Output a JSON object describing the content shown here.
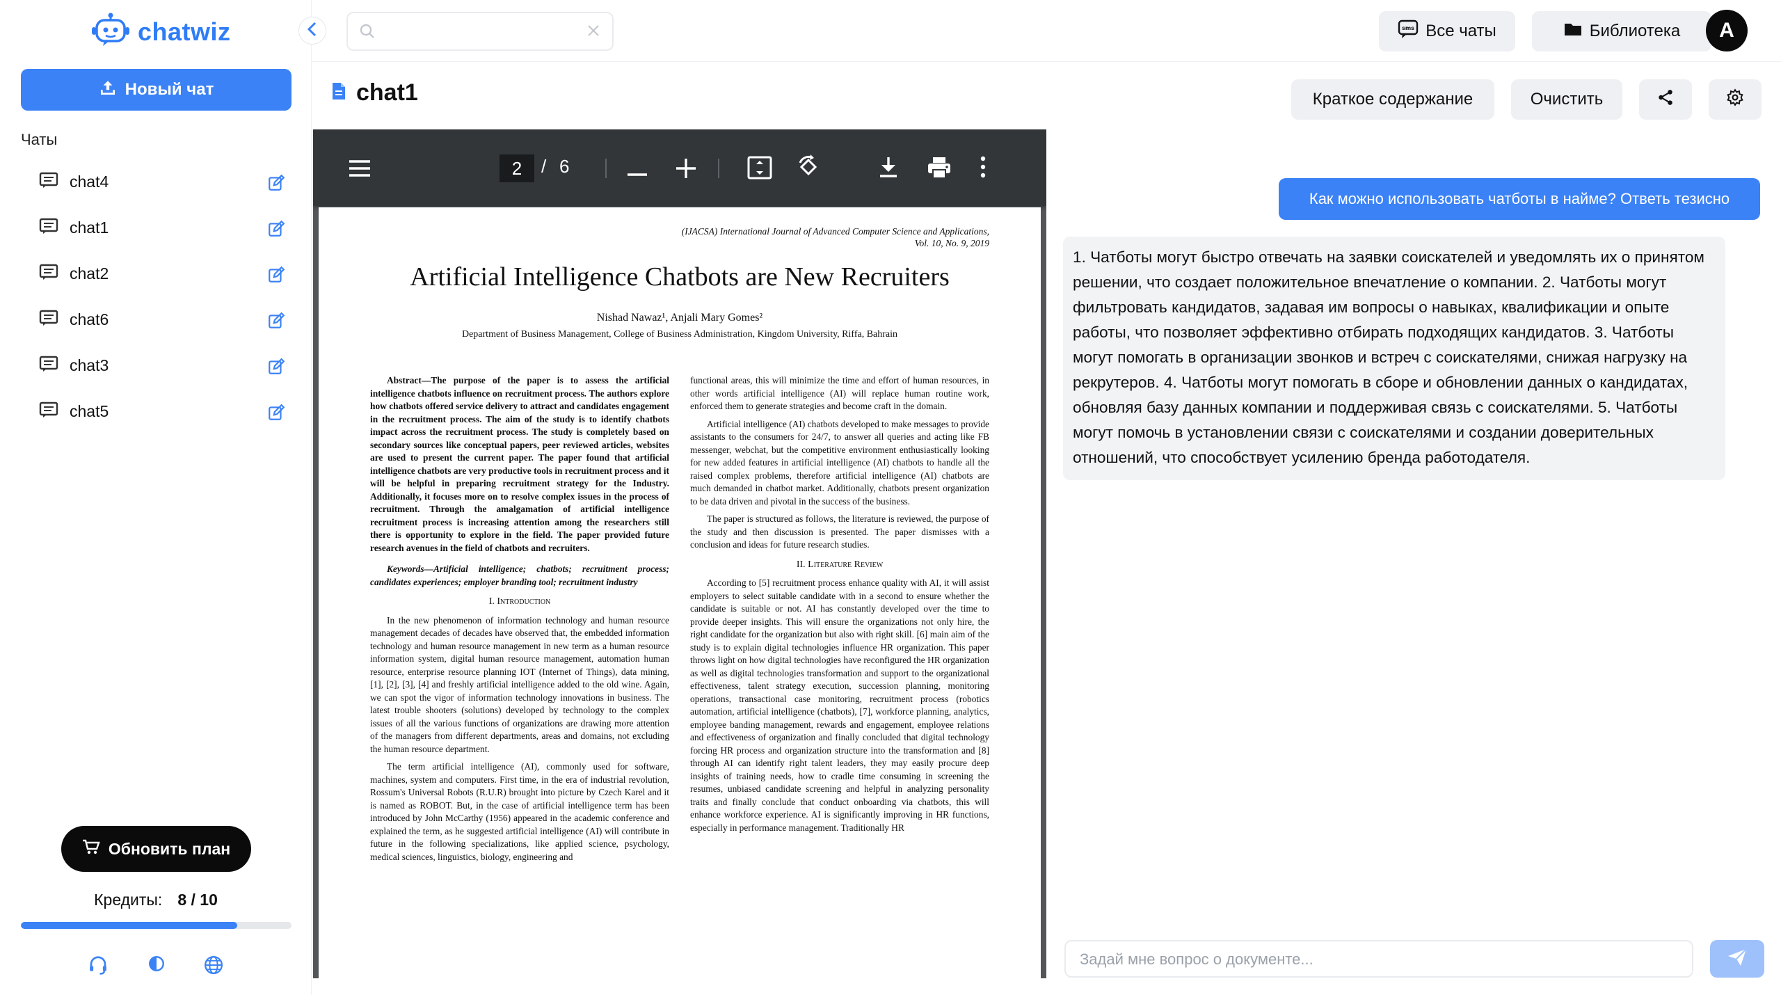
{
  "app": {
    "name": "chatwiz",
    "accent": "#3b82f6"
  },
  "sidebar": {
    "new_chat_label": "Новый чат",
    "chats_heading": "Чаты",
    "chats": [
      {
        "label": "chat4"
      },
      {
        "label": "chat1"
      },
      {
        "label": "chat2"
      },
      {
        "label": "chat6"
      },
      {
        "label": "chat3"
      },
      {
        "label": "chat5"
      }
    ],
    "upgrade_label": "Обновить план",
    "credits_label": "Кредиты:",
    "credits_value": "8 / 10",
    "credits_fraction": 0.8,
    "bottom_icons": [
      "headset-icon",
      "contrast-icon",
      "globe-icon"
    ]
  },
  "search": {
    "placeholder": ""
  },
  "header": {
    "all_chats_label": "Все чаты",
    "library_label": "Библиотека",
    "avatar_letter": "A"
  },
  "document": {
    "title": "chat1",
    "summary_label": "Краткое содержание",
    "clear_label": "Очистить"
  },
  "pdf": {
    "current_page": "2",
    "separator": "/",
    "total_pages": "6",
    "journal_line1": "(IJACSA) International Journal of Advanced Computer Science and Applications,",
    "journal_line2": "Vol. 10, No. 9, 2019",
    "title": "Artificial Intelligence Chatbots are New Recruiters",
    "authors": "Nishad Nawaz¹, Anjali Mary Gomes²",
    "department": "Department of Business Management, College of Business Administration, Kingdom University, Riffa, Bahrain",
    "abstract": "Abstract—The purpose of the paper is to assess the artificial intelligence chatbots influence on recruitment process. The authors explore how chatbots offered service delivery to attract and candidates engagement in the recruitment process. The aim of the study is to identify chatbots impact across the recruitment process. The study is completely based on secondary sources like conceptual papers, peer reviewed articles, websites are used to present the current paper. The paper found that artificial intelligence chatbots are very productive tools in recruitment process and it will be helpful in preparing recruitment strategy for the Industry. Additionally, it focuses more on to resolve complex issues in the process of recruitment. Through the amalgamation of artificial intelligence recruitment process is increasing attention among the researchers still there is opportunity to explore in the field. The paper provided future research avenues in the field of chatbots and recruiters.",
    "keywords": "Keywords—Artificial intelligence; chatbots; recruitment process; candidates experiences; employer branding tool; recruitment industry",
    "sec1": "I. Introduction",
    "intro_p1": "In the new phenomenon of information technology and human resource management decades of decades have observed that, the embedded information technology and human resource management in new term as a human resource information system, digital human resource management, automation human resource, enterprise resource planning IOT (Internet of Things), data mining, [1], [2], [3], [4] and freshly artificial intelligence added to the old wine. Again, we can spot the vigor of information technology innovations in business. The latest trouble shooters (solutions) developed by technology to the complex issues of all the various functions of organizations are drawing more attention of the managers from different departments, areas and domains, not excluding the human resource department.",
    "intro_p2": "The term artificial intelligence (AI), commonly used for software, machines, system and computers. First time, in the era of industrial revolution, Rossum's Universal Robots (R.U.R) brought into picture by Czech Karel and it is named as ROBOT. But, in the case of artificial intelligence term has been introduced by John McCarthy (1956) appeared in the academic conference and explained the term, as he suggested artificial intelligence (AI) will contribute in future in the following specializations, like applied science, psychology, medical sciences, linguistics, biology, engineering and",
    "right_p1": "functional areas, this will minimize the time and effort of human resources, in other words artificial intelligence (AI) will replace human routine work, enforced them to generate strategies and become craft in the domain.",
    "right_p2": "Artificial intelligence (AI) chatbots developed to make messages to provide assistants to the consumers for 24/7, to answer all queries and acting like FB messenger, webchat, but the competitive environment enthusiastically looking for new added features in artificial intelligence (AI) chatbots to handle all the raised complex problems, therefore artificial intelligence (AI) chatbots are much demanded in chatbot market. Additionally, chatbots present organization to be data driven and pivotal in the success of the business.",
    "right_p3": "The paper is structured as follows, the literature is reviewed, the purpose of the study and then discussion is presented. The paper dismisses with a conclusion and ideas for future research studies.",
    "sec2": "II. Literature Review",
    "right_p4": "According to [5] recruitment process enhance quality with AI, it will assist employers to select suitable candidate with in a second to ensure whether the candidate is suitable or not. AI has constantly developed over the time to provide deeper insights. This will ensure the organizations not only hire, the right candidate for the organization but also with right skill. [6] main aim of the study is to explain digital technologies influence HR organization. This paper throws light on how digital technologies have reconfigured the HR organization as well as digital technologies transformation and support to the organizational effectiveness, talent strategy execution, succession planning, monitoring operations, transactional case monitoring, recruitment process (robotics automation, artificial intelligence (chatbots), [7], workforce planning, analytics, employee banding management, rewards and engagement, employee relations and effectiveness of organization and finally concluded that digital technology forcing HR process and organization structure into the transformation and [8] through AI can identify right talent leaders, they may easily procure deep insights of training needs, how to cradle time consuming in screening the resumes, unbiased candidate screening and helpful in analyzing personality traits and finally conclude that conduct onboarding via chatbots, this will enhance workforce experience. AI is significantly improving in HR functions, especially in performance management. Traditionally HR"
  },
  "chat": {
    "user_message": "Как можно использовать чатботы в найме? Ответь тезисно",
    "bot_message": "1. Чатботы могут быстро отвечать на заявки соискателей и уведомлять их о принятом решении, что создает положительное впечатление о компании. 2. Чатботы могут фильтровать кандидатов, задавая им вопросы о навыках, квалификации и опыте работы, что позволяет эффективно отбирать подходящих кандидатов. 3. Чатботы могут помогать в организации звонков и встреч с соискателями, снижая нагрузку на рекрутеров. 4. Чатботы могут помогать в сборе и обновлении данных о кандидатах, обновляя базу данных компании и поддерживая связь с соискателями. 5. Чатботы могут помочь в установлении связи с соискателями и создании доверительных отношений, что способствует усилению бренда работодателя.",
    "input_placeholder": "Задай мне вопрос о документе..."
  }
}
